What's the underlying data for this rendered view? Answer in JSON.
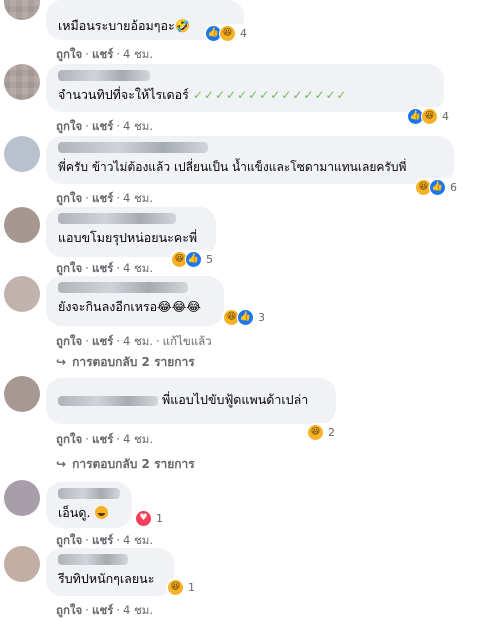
{
  "comments": [
    {
      "text": "เหมือนระบายอ้อมๆอะ🤣",
      "like": "ถูกใจ",
      "reply": "ตอบกลับ",
      "share": "แชร์",
      "time": "4 ชม.",
      "count": "4"
    },
    {
      "text": "จำนวนทิปที่จะให้ไรเดอร์",
      "checks": "✓✓✓✓✓✓✓✓✓✓✓✓✓✓",
      "like": "ถูกใจ",
      "share": "แชร์",
      "time": "4 ชม.",
      "count": "4"
    },
    {
      "text": "พี่ครับ ข้าวไม่ต้องแล้ว เปลี่ยนเป็น น้ำแข็งและโซดามาแทนเลยครับพี่",
      "like": "ถูกใจ",
      "share": "แชร์",
      "time": "4 ชม.",
      "count": "6"
    },
    {
      "text": "แอบขโมยรุปหน่อยนะคะพี่",
      "like": "ถูกใจ",
      "share": "แชร์",
      "time": "4 ชม.",
      "count": "5"
    },
    {
      "text": "ยังจะกินลงอีกเหรอ😂😂😂",
      "like": "ถูกใจ",
      "share": "แชร์",
      "time": "4 ชม.",
      "edited": "แก้ไขแล้ว",
      "count": "3",
      "replies": "การตอบกลับ 2 รายการ"
    },
    {
      "text": "พี่แอบไปขับฟู้ดแพนด้าเปล่า",
      "like": "ถูกใจ",
      "share": "แชร์",
      "time": "4 ชม.",
      "count": "2",
      "replies": "การตอบกลับ 2 รายการ"
    },
    {
      "text": "เอ็นดู.",
      "like": "ถูกใจ",
      "share": "แชร์",
      "time": "4 ชม.",
      "count": "1"
    },
    {
      "text": "รีบทิปหนักๆเลยนะ",
      "like": "ถูกใจ",
      "share": "แชร์",
      "time": "4 ชม.",
      "count": "1"
    }
  ],
  "colors": {
    "like": "#1877f2",
    "haha": "#f7b125",
    "love": "#f33e58",
    "bubble": "#f0f2f5",
    "meta": "#65676b"
  }
}
